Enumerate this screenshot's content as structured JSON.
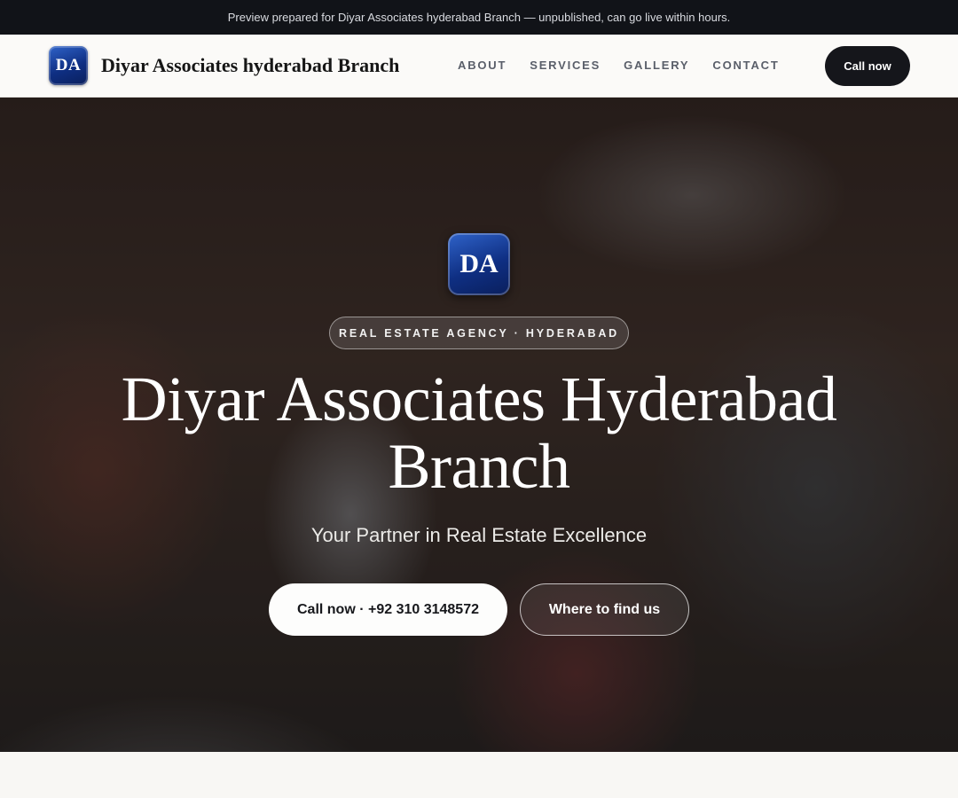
{
  "banner": {
    "text": "Preview prepared for Diyar Associates hyderabad Branch — unpublished, can go live within hours."
  },
  "header": {
    "logo_initials": "DA",
    "brand_name": "Diyar Associates hyderabad Branch",
    "nav": [
      {
        "label": "ABOUT"
      },
      {
        "label": "SERVICES"
      },
      {
        "label": "GALLERY"
      },
      {
        "label": "CONTACT"
      }
    ],
    "cta_label": "Call now"
  },
  "hero": {
    "logo_initials": "DA",
    "tagline": "REAL ESTATE AGENCY · HYDERABAD",
    "title": "Diyar Associates Hyderabad Branch",
    "subtitle": "Your Partner in Real Estate Excellence",
    "call_button": "Call now · +92 310 3148572",
    "find_button": "Where to find us"
  },
  "colors": {
    "banner_bg": "#111318",
    "brand_blue": "#0f2f83",
    "dark_button": "#15161b",
    "page_bg": "#f8f7f4"
  }
}
